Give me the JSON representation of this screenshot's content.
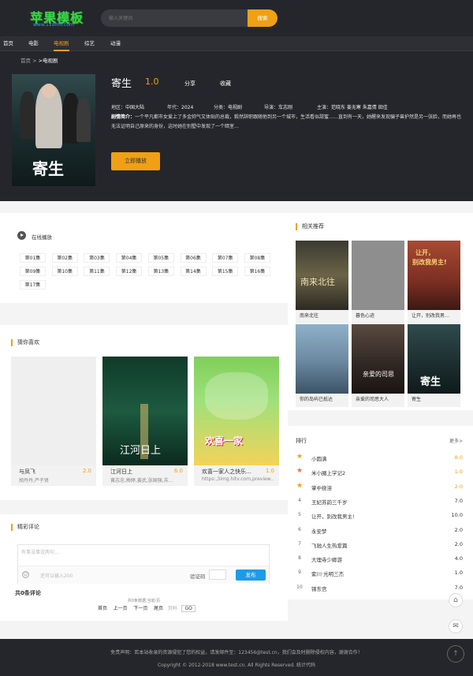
{
  "header": {
    "logo_main": "苹果模板",
    "logo_sub": "www.11dmh.com",
    "search_placeholder": "输入关键词",
    "search_button": "搜索"
  },
  "nav": [
    "首页",
    "电影",
    "电视剧",
    "综艺",
    "动漫"
  ],
  "breadcrumb": {
    "home": "首页",
    "sep": " > ",
    "current": ">电视剧"
  },
  "detail": {
    "title": "寄生",
    "score": "1.0",
    "share": "分享",
    "favorite": "收藏",
    "poster_text": "寄生",
    "region_label": "地区：",
    "region": "中国大陆",
    "year_label": "年代：",
    "year": "2024",
    "genre_label": "分类：",
    "genre": "电视剧",
    "director_label": "导演：",
    "director": "车志刚",
    "cast_label": "主演：",
    "cast": "范晓东 姜无寒 朱嘉倩 田佳",
    "desc_label": "剧情简介：",
    "desc": "一个平凡都市女爱上了多金帅气又体贴的总裁，毅然辞职跟随他到另一个城市，生活看似甜蜜……直到有一天，她醒来发现骗子兽护然是另一张脸，而她再也无法证明自己原来的身份，这时她在别墅中发现了一个暗室…",
    "play_button": "立即播放"
  },
  "playlist": {
    "title": "在线播放",
    "episodes": [
      "第01集",
      "第02集",
      "第03集",
      "第04集",
      "第05集",
      "第06集",
      "第07集",
      "第08集",
      "第09集",
      "第10集",
      "第11集",
      "第12集",
      "第13集",
      "第14集",
      "第15集",
      "第16集",
      "第17集"
    ]
  },
  "guess": {
    "title": "猜你喜欢",
    "items": [
      {
        "name": "与凤飞",
        "score": "2.0",
        "actors": "胡丹丹,严子贤"
      },
      {
        "name": "江河日上",
        "score": "6.0",
        "actors": "黄志忠,梅婷,姜武,张国强,苏…"
      },
      {
        "name": "欢喜一家人之快乐…",
        "score": "1.0",
        "actors": "https:,3img.hitv.com,preview…"
      }
    ],
    "poster_texts": [
      "江河日上",
      "欢喜一家"
    ]
  },
  "comments": {
    "title": "精彩评论",
    "placeholder": "有事没事说两句…",
    "limit": "还可以输入200",
    "captcha_label": "验证码",
    "submit": "发布",
    "total": "共0条评论",
    "pager_info": "共0条数据,当前/页",
    "pager": [
      "首页",
      "上一页",
      "下一页",
      "尾页"
    ],
    "page_input_placeholder": "页码",
    "go": "GO"
  },
  "related": {
    "title": "相关推荐",
    "items": [
      "南来北往",
      "暮色心迹",
      "让开，别改我男…",
      "你的岛屿已抵达",
      "亲爱的司思大人",
      "寄生"
    ]
  },
  "ranking": {
    "title": "排行",
    "more": "更多>",
    "items": [
      {
        "num": "1",
        "name": "小圆满",
        "score": "8.0"
      },
      {
        "num": "2",
        "name": "米小圈上学记2",
        "score": "1.0"
      },
      {
        "num": "3",
        "name": "掌中挠溶",
        "score": "2.0"
      },
      {
        "num": "4",
        "name": "王妃苏韵三千岁",
        "score": "7.0"
      },
      {
        "num": "5",
        "name": "让开，别改我男主!",
        "score": "10.0"
      },
      {
        "num": "6",
        "name": "永安梦",
        "score": "2.0"
      },
      {
        "num": "7",
        "name": "飞驰人生热爱篇",
        "score": "2.0"
      },
      {
        "num": "8",
        "name": "大理寺少卿游",
        "score": "4.0"
      },
      {
        "num": "9",
        "name": "紫川·光明三杰",
        "score": "1.0"
      },
      {
        "num": "10",
        "name": "锦东宫",
        "score": "7.0"
      }
    ]
  },
  "footer": {
    "disclaimer": "免责声明：若本站收录的资源侵犯了您的权益，请发邮件至：123456@test.cn，我们会及时删除侵权内容，谢谢合作！",
    "copyright": "Copyright © 2012-2018 www.test.cn. All Rights Reserved. 统计代码"
  },
  "colors": {
    "accent": "#f0a014",
    "dark": "#25262b",
    "submit": "#1e9be8"
  }
}
